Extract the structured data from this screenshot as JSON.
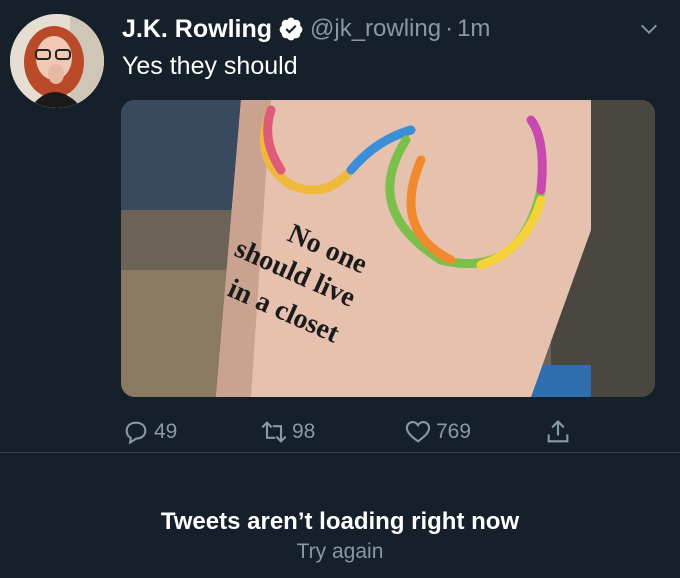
{
  "tweet": {
    "author_name": "J.K. Rowling",
    "handle": "@jk_rowling",
    "separator": "·",
    "time": "1m",
    "text": "Yes they should",
    "image": {
      "tattoo_lines": [
        "No one",
        "should live",
        "in a closet"
      ]
    },
    "actions": {
      "replies": "49",
      "retweets": "98",
      "likes": "769"
    }
  },
  "notice": {
    "title": "Tweets aren’t loading right now",
    "retry": "Try again"
  },
  "colors": {
    "background": "#15202b",
    "secondary_text": "#8899a6",
    "verified": "#ffffff"
  },
  "icons": [
    "verified-badge-icon",
    "chevron-down-icon",
    "reply-icon",
    "retweet-icon",
    "like-icon",
    "share-icon"
  ]
}
